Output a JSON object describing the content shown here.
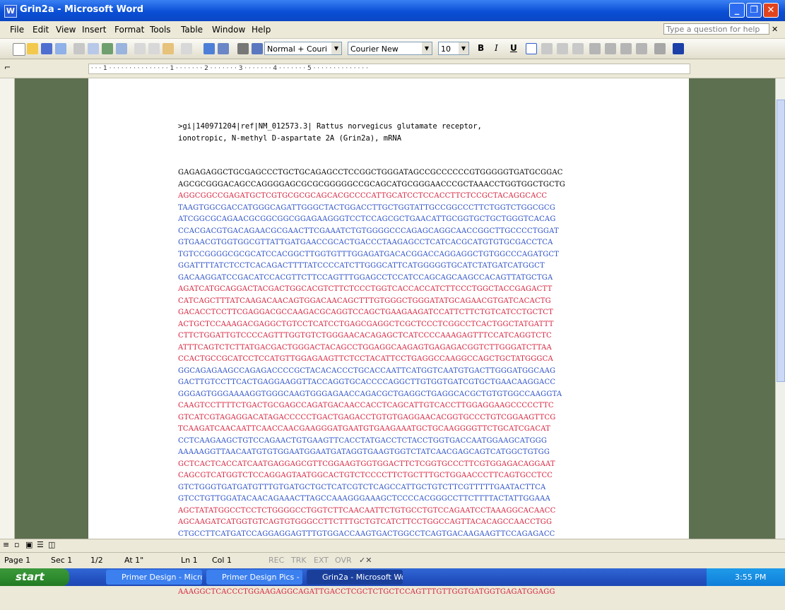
{
  "window": {
    "title": "Grin2a - Microsoft Word"
  },
  "menu": {
    "items": [
      "File",
      "Edit",
      "View",
      "Insert",
      "Format",
      "Tools",
      "Table",
      "Window",
      "Help"
    ],
    "help_placeholder": "Type a question for help"
  },
  "toolbar": {
    "style": "Normal + Couri",
    "font": "Courier New",
    "size": "10",
    "bold": "B",
    "italic": "I",
    "underline": "U"
  },
  "document": {
    "header": ">gi|140971204|ref|NM_012573.3| Rattus norvegicus glutamate receptor,\nionotropic, N-methyl D-aspartate 2A (Grin2a), mRNA",
    "lines": [
      {
        "text": "GAGAGAGGCTGCGAGCCCTGCTGCAGAGCCTCCGGCTGGGATAGCCGCCCCCCGTGGGGGTGATGCGGAC",
        "color": "#000000"
      },
      {
        "text": "AGCGCGGGACAGCCAGGGGAGCGCGCGGGGGCCGCAGCATGCGGGAACCCGCTAAACCTGGTGGCTGCTG",
        "color": "#000000"
      },
      {
        "text": "AGGCGGCCGAGATGCTCGTGCGCGCAGCACGCCCCATTGCATCCTCCACCTTCTCCGCTACAGGCACC",
        "color": "#d81f3a"
      },
      {
        "text": "TAAGTGGCGACCATGGGCAGATTGGGCTACTGGACCTTGCTGGTATTGCCGGCCCTTCTGGTCTGGCGCG",
        "color": "#2a4fc8"
      },
      {
        "text": "ATCGGCGCAGAACGCGGCGGCGGAGAAGGGTCCTCCAGCGCTGAACATTGCGGTGCTGCTGGGTCACAG",
        "color": "#2a4fc8"
      },
      {
        "text": "CCACGACGTGACAGAACGCGAACTTCGAAATCTGTGGGGCCCAGAGCAGGCAACCGGCTTGCCCCTGGAT",
        "color": "#2a4fc8"
      },
      {
        "text": "GTGAACGTGGTGGCGTTATTGATGAACCGCACTGACCCTAAGAGCCTCATCACGCATGTGTGCGACCTCA",
        "color": "#2a4fc8"
      },
      {
        "text": "TGTCCGGGGCGCGCATCCACGGCTTGGTGTTTGGAGATGACACGGACCAGGAGGCTGTGGCCCAGATGCT",
        "color": "#2a4fc8"
      },
      {
        "text": "GGATTTTATCTCCTCACAGACTTTTATCCCCATCTTGGGCATTCATGGGGGTGCATCTATGATCATGGCT",
        "color": "#2a4fc8"
      },
      {
        "text": "GACAAGGATCCGACATCCACGTTCTTCCAGTTTGGAGCCTCCATCCAGCAGCAAGCCACAGTTATGCTGA",
        "color": "#2a4fc8"
      },
      {
        "text": "AGATCATGCAGGACTACGACTGGCACGTCTTCTCCCTGGTCACCACCATCTTCCCTGGCTACCGAGACTT",
        "color": "#d81f3a"
      },
      {
        "text": "CATCAGCTTTATCAAGACAACAGTGGACAACAGCTTTGTGGGCTGGGATATGCAGAACGTGATCACACTG",
        "color": "#d81f3a"
      },
      {
        "text": "GACACCTCCTTCGAGGACGCCAAGACGCAGGTCCAGCTGAAGAAGATCCATTCTTCTGTCATCCTGCTCT",
        "color": "#d81f3a"
      },
      {
        "text": "ACTGCTCCAAAGACGAGGCTGTCCTCATCCTGAGCGAGGCTCGCTCCCTCGGCCTCACTGGCTATGATTT",
        "color": "#d81f3a"
      },
      {
        "text": "CTTCTGGATTGTCCCCAGTTTGGTGTCTGGGAACACAGAGCTCATCCCCAAAGAGTTTCCATCAGGTCTC",
        "color": "#d81f3a"
      },
      {
        "text": "ATTTCAGTCTCTTATGACGACTGGGACTACAGCCTGGAGGCAAGAGTGAGAGACGGTCTTGGGATCTTAA",
        "color": "#d81f3a"
      },
      {
        "text": "CCACTGCCGCATCCTCCATGTTGGAGAAGTTCTCCTACATTCCTGAGGCCAAGGCCAGCTGCTATGGGCA",
        "color": "#d81f3a"
      },
      {
        "text": "GGCAGAGAAGCCAGAGACCCCGCTACACACCCTGCACCAATTCATGGTCAATGTGACTTGGGATGGCAAG",
        "color": "#2a4fc8"
      },
      {
        "text": "GACTTGTCCTTCACTGAGGAAGGTTACCAGGTGCACCCCAGGCTTGTGGTGATCGTGCTGAACAAGGACC",
        "color": "#2a4fc8"
      },
      {
        "text": "GGGAGTGGGAAAAGGTGGGCAAGTGGGAGAACCAGACGCTGAGGCTGAGGCACGCTGTGTGGCCAAGGTA",
        "color": "#2a4fc8"
      },
      {
        "text": "CAAGTCCTTTTCTGACTGCGAGCCAGATGACAACCACCTCAGCATTGTCACCTTGGAGGAAGCCCCCTTC",
        "color": "#d81f3a"
      },
      {
        "text": "GTCATCGTAGAGGACATAGACCCCCTGACTGAGACCTGTGTGAGGAACACGGTGCCCTGTCGGAAGTTCG",
        "color": "#d81f3a"
      },
      {
        "text": "TCAAGATCAACAATTCAACCAACGAAGGGATGAATGTGAAGAAATGCTGCAAGGGGTTCTGCATCGACAT",
        "color": "#d81f3a"
      },
      {
        "text": "CCTCAAGAAGCTGTCCAGAACTGTGAAGTTCACCTATGACCTCTACCTGGTGACCAATGGAAGCATGGG",
        "color": "#2a4fc8"
      },
      {
        "text": "AAAAAGGTTAACAATGTGTGGAATGGAATGATAGGTGAAGTGGTCTATCAACGAGCAGTCATGGCTGTGG",
        "color": "#2a4fc8"
      },
      {
        "text": "GCTCACTCACCATCAATGAGGAGCGTTCGGAAGTGGTGGACTTCTCGGTGCCCTTCGTGGAGACAGGAAT",
        "color": "#d81f3a"
      },
      {
        "text": "CAGCGTCATGGTCTCCAGGAGTAATGGCACTGTCTCCCCTTCTGCTTTGCTGGAACCCTTCAGTGCCTCC",
        "color": "#d81f3a"
      },
      {
        "text": "GTCTGGGTGATGATGTTTGTGATGCTGCTCATCGTCTCAGCCATTGCTGTCTTCGTTTTTGAATACTTCA",
        "color": "#2a4fc8"
      },
      {
        "text": "GTCCTGTTGGATACAACAGAAACTTAGCCAAAGGGAAAGCTCCCCACGGGCCTTCTTTTACTATTGGAAA",
        "color": "#2a4fc8"
      },
      {
        "text": "AGCTATATGGCCTCCTCTGGGGCCTGGTCTTCAACAATTCTGTGCCTGTCCAGAATCCTAAAGGCACAACC",
        "color": "#d81f3a"
      },
      {
        "text": "AGCAAGATCATGGTGTCAGTGTGGGCCTTCTTTGCTGTCATCTTCCTGGCCAGTTACACAGCCAACCTGG",
        "color": "#d81f3a"
      },
      {
        "text": "CTGCCTTCATGATCCAGGAGGAGTTTGTGGACCAAGTGACTGGCCTCAGTGACAAGAAGTTCCAGAGACC",
        "color": "#2a4fc8"
      },
      {
        "text": "TCATGACTATTCTCCACCTTTCCGATTTGGGACGGTACCCAATGGAAGTACAGAGAGGAATATTCGTAAC",
        "color": "#2a4fc8"
      },
      {
        "text": "AACTACCCGTATATGCACCAGTACATGACCAGATTCAACCAGAGGGGAGTGGAGGATGCCTTGGTCAGCT",
        "color": "#2a4fc8"
      },
      {
        "text": "TGAAAACCGGGAAGTTGGACGCTTTCATCTATGACGCAGCCGTCTTGAACTACAAGGCCGGGAGGGATGA",
        "color": "#d81f3a"
      },
      {
        "text": "AGGCTGTAAACTGGTGACCATTGGGAGCGGGTACATCTTTGCTACCACAGGCTATGGAATTGCGCTGCAG",
        "color": "#d81f3a"
      },
      {
        "text": "AAAGGCTCACCCTGGAAGAGGCAGATTGACCTCGCTCTGCTCCAGTTTGTTGGTGATGGTGAGATGGAGG",
        "color": "#d81f3a"
      }
    ]
  },
  "status": {
    "page": "Page 1",
    "sec": "Sec 1",
    "pages": "1/2",
    "at": "At 1\"",
    "ln": "Ln 1",
    "col": "Col 1",
    "rec": "REC",
    "trk": "TRK",
    "ext": "EXT",
    "ovr": "OVR"
  },
  "taskbar": {
    "start": "start",
    "tasks": [
      "Primer Design - Micro...",
      "Primer Design Pics - M...",
      "Grin2a - Microsoft Word"
    ],
    "clock": "3:55 PM"
  }
}
